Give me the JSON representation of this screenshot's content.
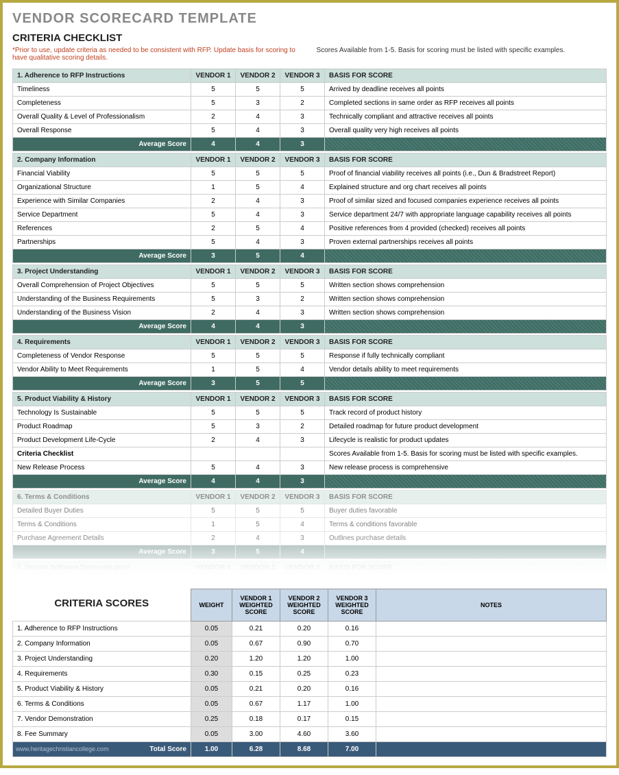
{
  "title": "VENDOR SCORECARD TEMPLATE",
  "subtitle": "CRITERIA CHECKLIST",
  "red_note": "*Prior to use, update criteria as needed to be consistent with RFP. Update basis for scoring to have qualitative scoring details.",
  "black_note": "Scores Available from 1-5. Basis for scoring must be listed with specific examples.",
  "headers": {
    "v1": "VENDOR 1",
    "v2": "VENDOR 2",
    "v3": "VENDOR 3",
    "basis": "BASIS FOR SCORE",
    "avg": "Average Score"
  },
  "sections": [
    {
      "title": "1. Adherence to RFP Instructions",
      "rows": [
        {
          "c": "Timeliness",
          "v": [
            5,
            5,
            5
          ],
          "b": "Arrived by deadline receives all points"
        },
        {
          "c": "Completeness",
          "v": [
            5,
            3,
            2
          ],
          "b": "Completed sections in same order as RFP receives all points"
        },
        {
          "c": "Overall Quality & Level of Professionalism",
          "v": [
            2,
            4,
            3
          ],
          "b": "Technically compliant and attractive receives all points"
        },
        {
          "c": "Overall Response",
          "v": [
            5,
            4,
            3
          ],
          "b": "Overall quality very high receives all points"
        }
      ],
      "avg": [
        4,
        4,
        3
      ]
    },
    {
      "title": "2. Company Information",
      "rows": [
        {
          "c": "Financial Viability",
          "v": [
            5,
            5,
            5
          ],
          "b": "Proof of financial viability receives all points (i.e., Dun & Bradstreet Report)"
        },
        {
          "c": "Organizational Structure",
          "v": [
            1,
            5,
            4
          ],
          "b": "Explained structure and org chart receives all points"
        },
        {
          "c": "Experience with Similar Companies",
          "v": [
            2,
            4,
            3
          ],
          "b": "Proof of similar sized and focused companies experience receives all points"
        },
        {
          "c": "Service Department",
          "v": [
            5,
            4,
            3
          ],
          "b": "Service department 24/7 with appropriate language capability receives all points"
        },
        {
          "c": "References",
          "v": [
            2,
            5,
            4
          ],
          "b": "Positive references from 4 provided (checked) receives all points"
        },
        {
          "c": "Partnerships",
          "v": [
            5,
            4,
            3
          ],
          "b": "Proven external partnerships receives all points"
        }
      ],
      "avg": [
        3,
        5,
        4
      ]
    },
    {
      "title": "3. Project Understanding",
      "rows": [
        {
          "c": "Overall Comprehension of Project Objectives",
          "v": [
            5,
            5,
            5
          ],
          "b": "Written section shows comprehension"
        },
        {
          "c": "Understanding of the Business Requirements",
          "v": [
            5,
            3,
            2
          ],
          "b": "Written section shows comprehension"
        },
        {
          "c": "Understanding of the Business Vision",
          "v": [
            2,
            4,
            3
          ],
          "b": "Written section shows comprehension"
        }
      ],
      "avg": [
        4,
        4,
        3
      ]
    },
    {
      "title": "4. Requirements",
      "rows": [
        {
          "c": "Completeness of Vendor Response",
          "v": [
            5,
            5,
            5
          ],
          "b": "Response if fully technically compliant"
        },
        {
          "c": "Vendor Ability to Meet Requirements",
          "v": [
            1,
            5,
            4
          ],
          "b": "Vendor details ability to meet requirements"
        }
      ],
      "avg": [
        3,
        5,
        5
      ]
    },
    {
      "title": "5. Product Viability & History",
      "rows": [
        {
          "c": "Technology Is Sustainable",
          "v": [
            5,
            5,
            5
          ],
          "b": "Track record of product history"
        },
        {
          "c": "Product Roadmap",
          "v": [
            5,
            3,
            2
          ],
          "b": "Detailed roadmap for future product development"
        },
        {
          "c": "Product Development Life-Cycle",
          "v": [
            2,
            4,
            3
          ],
          "b": "Lifecycle is realistic for product updates"
        },
        {
          "c": "Criteria Checklist",
          "v": [
            "",
            "",
            ""
          ],
          "b": "Scores Available from 1-5. Basis for scoring must be listed with specific examples.",
          "bold": true
        },
        {
          "c": "New Release Process",
          "v": [
            5,
            4,
            3
          ],
          "b": "New release process is comprehensive"
        }
      ],
      "avg": [
        4,
        4,
        3
      ]
    },
    {
      "title": "6. Terms & Conditions",
      "rows": [
        {
          "c": "Detailed Buyer Duties",
          "v": [
            5,
            5,
            5
          ],
          "b": "Buyer duties favorable"
        },
        {
          "c": "Terms & Conditions",
          "v": [
            1,
            5,
            4
          ],
          "b": "Terms & conditions favorable"
        },
        {
          "c": "Purchase Agreement Details",
          "v": [
            2,
            4,
            3
          ],
          "b": "Outlines purchase details"
        }
      ],
      "avg": [
        3,
        5,
        4
      ],
      "faded": true
    },
    {
      "title": "7. Vendor Software Demonstration",
      "rows": [],
      "avg": null,
      "faded2": true
    }
  ],
  "scores_title": "CRITERIA SCORES",
  "scores_headers": {
    "weight": "WEIGHT",
    "v1": "VENDOR 1 WEIGHTED SCORE",
    "v2": "VENDOR 2 WEIGHTED SCORE",
    "v3": "VENDOR 3 WEIGHTED SCORE",
    "notes": "NOTES"
  },
  "scores_rows": [
    {
      "c": "1. Adherence to RFP Instructions",
      "w": "0.05",
      "v": [
        "0.21",
        "0.20",
        "0.16"
      ]
    },
    {
      "c": "2. Company Information",
      "w": "0.05",
      "v": [
        "0.67",
        "0.90",
        "0.70"
      ]
    },
    {
      "c": "3. Project Understanding",
      "w": "0.20",
      "v": [
        "1.20",
        "1.20",
        "1.00"
      ]
    },
    {
      "c": "4. Requirements",
      "w": "0.30",
      "v": [
        "0.15",
        "0.25",
        "0.23"
      ]
    },
    {
      "c": "5. Product Viability & History",
      "w": "0.05",
      "v": [
        "0.21",
        "0.20",
        "0.16"
      ]
    },
    {
      "c": "6. Terms & Conditions",
      "w": "0.05",
      "v": [
        "0.67",
        "1.17",
        "1.00"
      ]
    },
    {
      "c": "7. Vendor Demonstration",
      "w": "0.25",
      "v": [
        "0.18",
        "0.17",
        "0.15"
      ]
    },
    {
      "c": "8. Fee Summary",
      "w": "0.05",
      "v": [
        "3.00",
        "4.60",
        "3.60"
      ]
    }
  ],
  "total_row": {
    "label": "Total Score",
    "w": "1.00",
    "v": [
      "6.28",
      "8.68",
      "7.00"
    ]
  },
  "watermark": "www.heritagechristiancollege.com"
}
